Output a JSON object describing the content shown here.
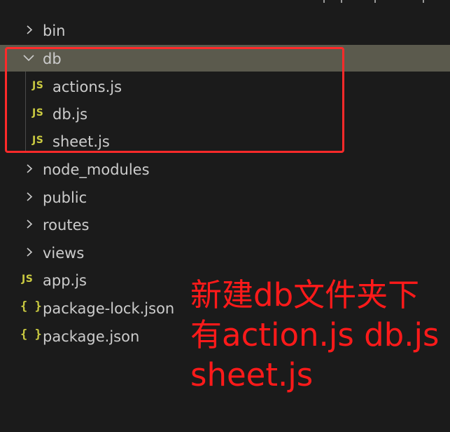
{
  "explorer": {
    "items": [
      {
        "label": "bin",
        "kind": "folder",
        "expanded": false
      },
      {
        "label": "db",
        "kind": "folder",
        "expanded": true,
        "selected": true
      },
      {
        "label": "actions.js",
        "kind": "js"
      },
      {
        "label": "db.js",
        "kind": "js"
      },
      {
        "label": "sheet.js",
        "kind": "js"
      },
      {
        "label": "node_modules",
        "kind": "folder",
        "expanded": false
      },
      {
        "label": "public",
        "kind": "folder",
        "expanded": false
      },
      {
        "label": "routes",
        "kind": "folder",
        "expanded": false
      },
      {
        "label": "views",
        "kind": "folder",
        "expanded": false
      },
      {
        "label": "app.js",
        "kind": "js"
      },
      {
        "label": "package-lock.json",
        "kind": "json"
      },
      {
        "label": "package.json",
        "kind": "json"
      }
    ],
    "js_icon_text": "JS",
    "json_icon_text": "{ }"
  },
  "annotation": {
    "lines": [
      "新建db文件夹下",
      "有action.js db.js",
      "sheet.js"
    ]
  },
  "colors": {
    "background": "#1b1b1b",
    "selected_row": "#5b5a4d",
    "text": "#cccccc",
    "js_icon": "#cbcb41",
    "annotation": "#ff1a1a",
    "highlight_border": "#ff2a2a"
  },
  "icons": {
    "collapsed": "chevron-right-icon",
    "expanded": "chevron-down-icon",
    "js_file": "js-file-icon",
    "json_file": "json-file-icon"
  }
}
